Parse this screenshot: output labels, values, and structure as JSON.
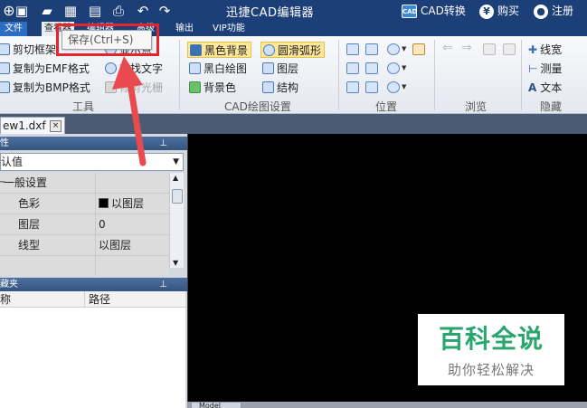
{
  "titlebar": {
    "title": "迅捷CAD编辑器",
    "convert_badge": "CAD",
    "convert_label": "CAD转换",
    "buy_label": "购买",
    "register_label": "注册"
  },
  "menu": {
    "file": "文件",
    "view": "查看器",
    "editor": "编辑器",
    "advanced": "高级",
    "output": "输出",
    "vip": "VIP功能"
  },
  "tooltip": "保存(Ctrl+S)",
  "ribbon": {
    "tools": {
      "label": "工具",
      "items": [
        "剪切框架",
        "复制为EMF格式",
        "复制为BMP格式",
        "显示点",
        "查找文字",
        "修剪光栅"
      ]
    },
    "cad_settings": {
      "label": "CAD绘图设置",
      "items": [
        "黑色背景",
        "黑白绘图",
        "背景色",
        "圆滑弧形",
        "图层",
        "结构"
      ]
    },
    "position": {
      "label": "位置"
    },
    "browse": {
      "label": "浏览"
    },
    "hide": {
      "label": "隐藏",
      "items": [
        "线宽",
        "测量",
        "文本"
      ]
    }
  },
  "doc_tab": {
    "name": "ew1.dxf",
    "close": "×"
  },
  "properties": {
    "header": "性",
    "combo_value": "认值",
    "category": "一般设置",
    "rows": [
      {
        "name": "色彩",
        "value": "以图层"
      },
      {
        "name": "图层",
        "value": "0"
      },
      {
        "name": "线型",
        "value": "以图层"
      }
    ]
  },
  "favorites": {
    "header": "藏夹",
    "col_name": "称",
    "col_path": "路径"
  },
  "model_tab": "Model",
  "watermark": {
    "title": "百科全说",
    "subtitle": "助你轻松解决"
  },
  "colors": {
    "titlebar": "#1c3f78",
    "highlight_box": "#e6242b",
    "arrow": "#e84a4e",
    "watermark_green": "#28a66e"
  }
}
